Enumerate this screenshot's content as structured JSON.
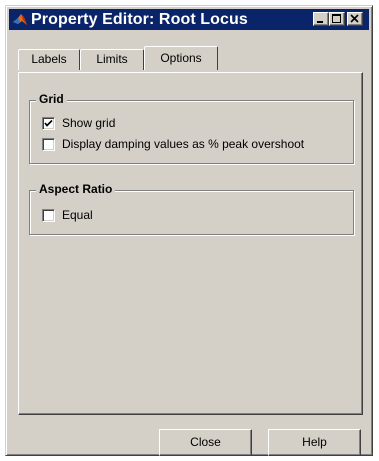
{
  "window": {
    "title": "Property Editor: Root Locus",
    "icon": "matlab-icon",
    "controls": [
      "minimize-icon",
      "maximize-icon",
      "close-icon"
    ]
  },
  "tabs": [
    {
      "label": "Labels",
      "active": false
    },
    {
      "label": "Limits",
      "active": false
    },
    {
      "label": "Options",
      "active": true
    }
  ],
  "grid_group": {
    "title": "Grid",
    "options": [
      {
        "label": "Show grid",
        "checked": true
      },
      {
        "label": "Display damping values as % peak overshoot",
        "checked": false
      }
    ]
  },
  "aspect_group": {
    "title": "Aspect Ratio",
    "options": [
      {
        "label": "Equal",
        "checked": false
      }
    ]
  },
  "buttons": {
    "close": "Close",
    "help": "Help"
  }
}
